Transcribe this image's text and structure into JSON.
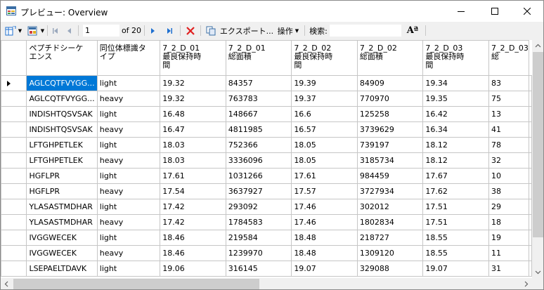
{
  "window": {
    "title": "プレビュー: Overview"
  },
  "toolbar": {
    "position": "1",
    "of_text": "of 20",
    "export_label": "エクスポート...",
    "operations_label": "操作",
    "search_label": "検索:",
    "font_icon_label": "Aª"
  },
  "table": {
    "columns": [
      "ペプチドシーケ\nエンス",
      "同位体標識タ\nイプ",
      "7_2_D_01\n最良保持時\n間",
      "7_2_D_01\n総面積",
      "7_2_D_02\n最良保持時\n間",
      "7_2_D_02\n総面積",
      "7_2_D_03\n最良保持時\n間",
      "7_2_D_03\n総"
    ],
    "rows": [
      [
        "AGLCQTFVYGG...",
        "light",
        "19.32",
        "84357",
        "19.39",
        "84909",
        "19.34",
        "83"
      ],
      [
        "AGLCQTFVYGG...",
        "heavy",
        "19.32",
        "763783",
        "19.37",
        "770970",
        "19.35",
        "75"
      ],
      [
        "INDISHTQSVSAK",
        "light",
        "16.48",
        "148667",
        "16.6",
        "125258",
        "16.42",
        "13"
      ],
      [
        "INDISHTQSVSAK",
        "heavy",
        "16.47",
        "4811985",
        "16.57",
        "3739629",
        "16.34",
        "41"
      ],
      [
        "LFTGHPETLEK",
        "light",
        "18.03",
        "752366",
        "18.05",
        "739197",
        "18.12",
        "78"
      ],
      [
        "LFTGHPETLEK",
        "heavy",
        "18.03",
        "3336096",
        "18.05",
        "3185734",
        "18.12",
        "32"
      ],
      [
        "HGFLPR",
        "light",
        "17.61",
        "1031266",
        "17.61",
        "984459",
        "17.67",
        "10"
      ],
      [
        "HGFLPR",
        "heavy",
        "17.54",
        "3637927",
        "17.57",
        "3727934",
        "17.62",
        "38"
      ],
      [
        "YLASASTMDHAR",
        "light",
        "17.42",
        "293092",
        "17.46",
        "302012",
        "17.51",
        "29"
      ],
      [
        "YLASASTMDHAR",
        "heavy",
        "17.42",
        "1784583",
        "17.46",
        "1802834",
        "17.51",
        "18"
      ],
      [
        "IVGGWECEK",
        "light",
        "18.46",
        "219584",
        "18.48",
        "218727",
        "18.55",
        "19"
      ],
      [
        "IVGGWECEK",
        "heavy",
        "18.46",
        "1239970",
        "18.48",
        "1309120",
        "18.55",
        "11"
      ],
      [
        "LSEPAELTDAVK",
        "light",
        "19.06",
        "316145",
        "19.07",
        "329088",
        "19.07",
        "31"
      ]
    ]
  },
  "colors": {
    "selection": "#0078d7",
    "nav_blue": "#1e6fd0",
    "delete_red": "#e02020",
    "grid_line": "#c6c6c6"
  },
  "icons": [
    "app-icon",
    "minimize-icon",
    "maximize-icon",
    "close-icon",
    "columns-icon",
    "filter-icon",
    "first-page-icon",
    "prev-page-icon",
    "next-page-icon",
    "last-page-icon",
    "delete-icon",
    "copy-icon",
    "font-icon"
  ]
}
